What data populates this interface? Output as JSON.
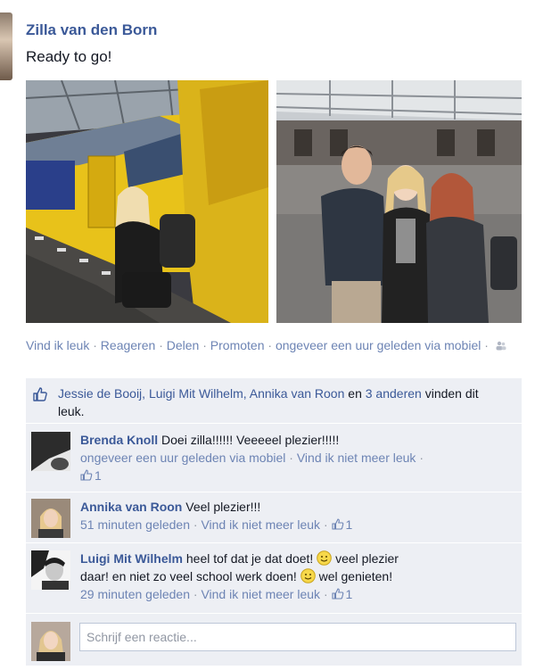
{
  "post": {
    "author": "Zilla van den Born",
    "text": "Ready to go!"
  },
  "photos": [
    {
      "icon": "photo-train-platform"
    },
    {
      "icon": "photo-group-station"
    }
  ],
  "actions": {
    "like": "Vind ik leuk",
    "comment": "Reageren",
    "share": "Delen",
    "promote": "Promoten",
    "time_prefix": "ongeveer een uur geleden via",
    "via": "mobiel",
    "separator": "·"
  },
  "likes": {
    "names": "Jessie de Booij, Luigi Mit Wilhelm, Annika van Roon",
    "joiner": "en",
    "others": "3 anderen",
    "suffix": "vinden dit leuk."
  },
  "comments": [
    {
      "author": "Brenda Knoll",
      "text": "Doei zilla!!!!!! Veeeeel plezier!!!!!",
      "time": "ongeveer een uur geleden via mobiel",
      "unlike": "Vind ik niet meer leuk",
      "likes": "1"
    },
    {
      "author": "Annika van Roon",
      "text": "Veel plezier!!!",
      "time": "51 minuten geleden",
      "unlike": "Vind ik niet meer leuk",
      "likes": "1"
    },
    {
      "author": "Luigi Mit Wilhelm",
      "text_1": "heel tof dat je dat doet!",
      "text_2": "veel plezier",
      "text_3": "daar! en niet zo veel school werk doen!",
      "text_4": "wel genieten!",
      "time": "29 minuten geleden",
      "unlike": "Vind ik niet meer leuk",
      "likes": "1"
    }
  ],
  "reply": {
    "placeholder": "Schrijf een reactie..."
  },
  "colors": {
    "link": "#3b5998",
    "meta_link": "#6d84b4",
    "ufi_background": "#edeff4"
  }
}
